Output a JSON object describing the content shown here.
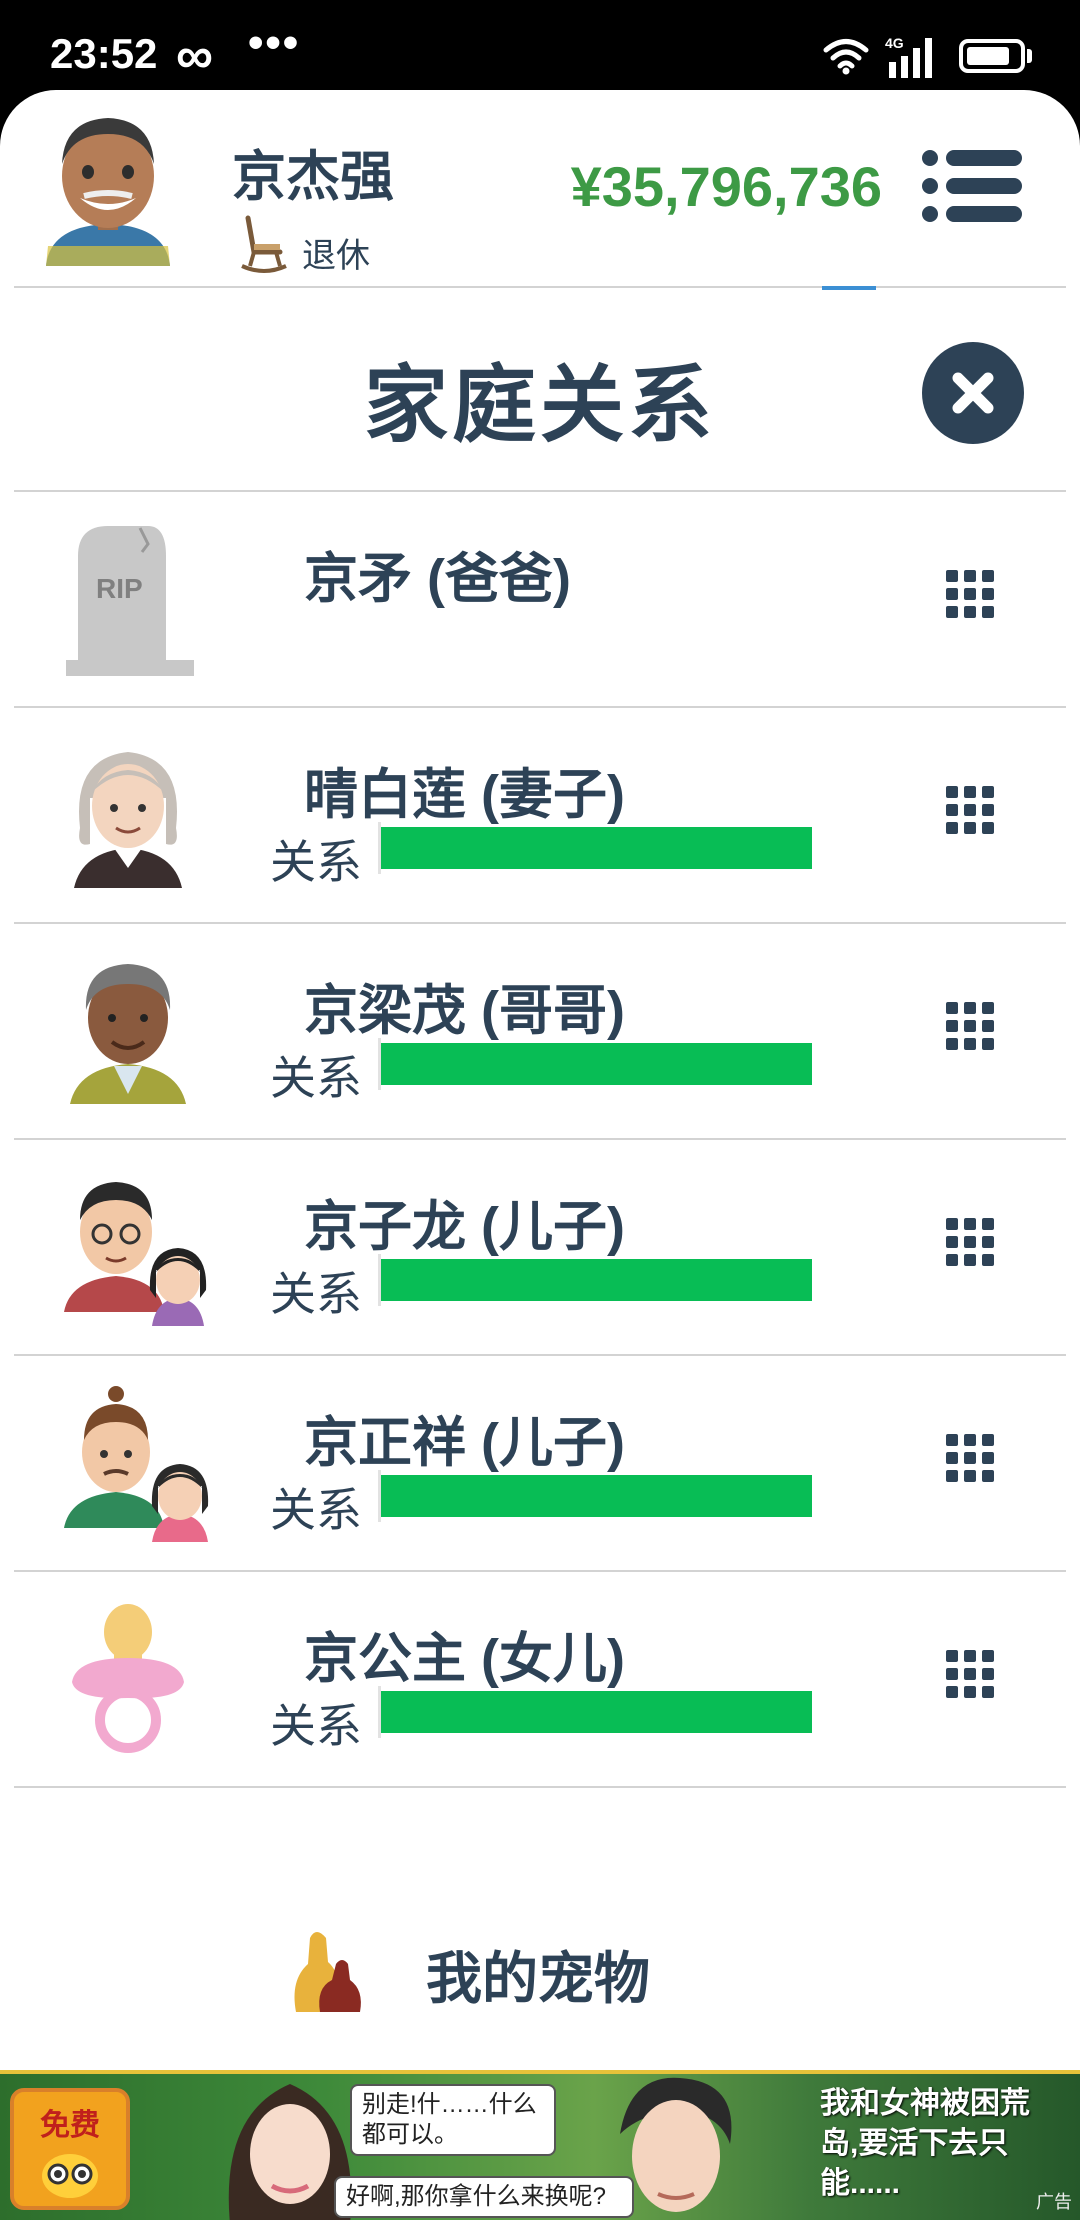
{
  "status_bar": {
    "time": "23:52",
    "infinity_symbol": "∞",
    "dots": "•••",
    "network": "4G",
    "icons": [
      "wifi-icon",
      "signal-icon",
      "battery-icon"
    ]
  },
  "header": {
    "player_name": "京杰强",
    "status_label": "退休",
    "money": "¥35,796,736",
    "menu_icon": "list-menu-icon"
  },
  "page": {
    "title": "家庭关系",
    "close_icon": "close-icon"
  },
  "relatives": [
    {
      "name": "京矛 (爸爸)",
      "deceased": true,
      "avatar": "tombstone-icon",
      "tombstone_text": "RIP"
    },
    {
      "name": "晴白莲 (妻子)",
      "relation_label": "关系",
      "relation_level": 1.0,
      "avatar": "elderly-woman-avatar"
    },
    {
      "name": "京梁茂 (哥哥)",
      "relation_label": "关系",
      "relation_level": 1.0,
      "avatar": "elderly-man-avatar"
    },
    {
      "name": "京子龙 (儿子)",
      "relation_label": "关系",
      "relation_level": 1.0,
      "avatar": "man-with-child-avatar"
    },
    {
      "name": "京正祥 (儿子)",
      "relation_label": "关系",
      "relation_level": 1.0,
      "avatar": "man-with-child-avatar"
    },
    {
      "name": "京公主 (女儿)",
      "relation_label": "关系",
      "relation_level": 1.0,
      "avatar": "pacifier-icon"
    }
  ],
  "pets": {
    "label": "我的宠物",
    "icon": "pets-icon"
  },
  "ad": {
    "free_label": "免费",
    "bubble_1": "别走!什……什么都可以。",
    "bubble_2": "好啊,那你拿什么来换呢?",
    "right_text": "我和女神被困荒岛,要活下去只能......",
    "tag": "广告"
  },
  "colors": {
    "accent_dark": "#2d4256",
    "money_green": "#3d9a45",
    "relation_bar": "#08bd55"
  }
}
